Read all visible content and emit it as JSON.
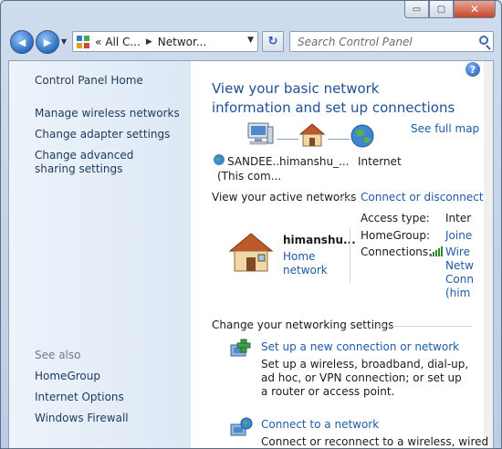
{
  "window": {
    "minimize_glyph": "▭",
    "maximize_glyph": "▢",
    "close_glyph": "✕"
  },
  "navbar": {
    "back_glyph": "◀",
    "forward_glyph": "▶",
    "dropdown_glyph": "▼",
    "breadcrumb_prefix": "«",
    "breadcrumb": [
      "All C...",
      "Networ..."
    ],
    "breadcrumb_sep": "▶",
    "address_dropdown_glyph": "▼",
    "refresh_glyph": "↻",
    "search_placeholder": "Search Control Panel"
  },
  "sidebar": {
    "home": "Control Panel Home",
    "tasks": [
      "Manage wireless networks",
      "Change adapter settings",
      "Change advanced sharing settings"
    ],
    "see_also_label": "See also",
    "see_also": [
      "HomeGroup",
      "Internet Options",
      "Windows Firewall"
    ]
  },
  "main": {
    "help_glyph": "?",
    "title": "View your basic network information and set up connections",
    "see_full_map": "See full map",
    "map": {
      "computer_name": "SANDEE...",
      "computer_sub": "(This com...",
      "network_name": "himanshu_...",
      "internet": "Internet"
    },
    "active_networks_label": "View your active networks",
    "connect_disconnect": "Connect or disconnect",
    "network": {
      "name": "himanshu...",
      "type_link": "Home network",
      "access_type_label": "Access type:",
      "access_type_value": "Inter",
      "homegroup_label": "HomeGroup:",
      "homegroup_value": "Joine",
      "connections_label": "Connections:",
      "connections_value": "Wire Netw Conn (him"
    },
    "change_settings_label": "Change your networking settings",
    "tasks": [
      {
        "title": "Set up a new connection or network",
        "desc": "Set up a wireless, broadband, dial-up, ad hoc, or VPN connection; or set up a router or access point."
      },
      {
        "title": "Connect to a network",
        "desc": "Connect or reconnect to a wireless, wired"
      }
    ]
  }
}
